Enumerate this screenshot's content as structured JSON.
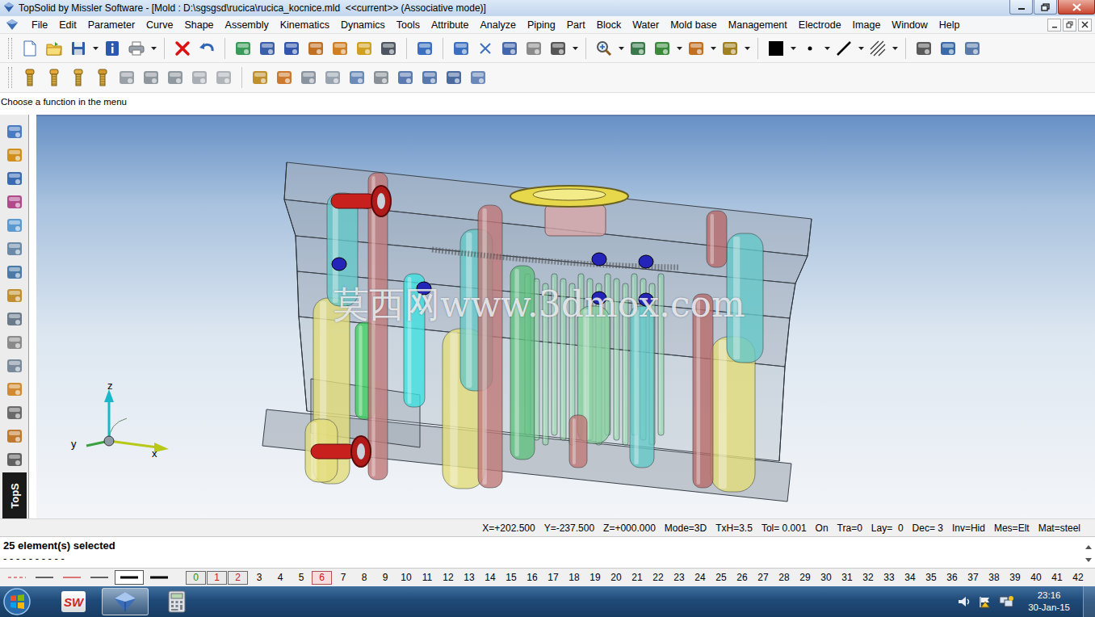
{
  "window": {
    "title": "TopSolid by Missler Software - [Mold : D:\\sgsgsd\\rucica\\rucica_kocnice.mld  <<current>> (Associative mode)]"
  },
  "menu": [
    "File",
    "Edit",
    "Parameter",
    "Curve",
    "Shape",
    "Assembly",
    "Kinematics",
    "Dynamics",
    "Tools",
    "Attribute",
    "Analyze",
    "Piping",
    "Part",
    "Block",
    "Water",
    "Mold base",
    "Management",
    "Electrode",
    "Image",
    "Window",
    "Help"
  ],
  "prompt": "Choose a function in the menu",
  "side_toolbar": {
    "label": "TopS"
  },
  "viewport": {
    "watermark": "莫西网www.3dmox.com",
    "axes": {
      "z": "z",
      "y": "y",
      "x": "x"
    }
  },
  "status_bar": [
    "X=+202.500",
    "Y=-237.500",
    "Z=+000.000",
    "Mode=3D",
    "TxH=3.5",
    "Tol= 0.001",
    "On",
    "Tra=0",
    "Lay=  0",
    "Dec= 3",
    "Inv=Hid",
    "Mes=Elt",
    "Mat=steel"
  ],
  "messages": [
    "25 element(s) selected",
    "- - - - - - - - - -"
  ],
  "line_styles": [
    {
      "kind": "dash",
      "color": "#d02020",
      "selected": false
    },
    {
      "kind": "solid",
      "color": "#000000",
      "selected": false
    },
    {
      "kind": "solid",
      "color": "#d02020",
      "selected": false
    },
    {
      "kind": "solid",
      "color": "#000000",
      "selected": false
    },
    {
      "kind": "thick",
      "color": "#000000",
      "selected": true
    },
    {
      "kind": "thick",
      "color": "#000000",
      "selected": false
    }
  ],
  "layers": [
    {
      "label": "0",
      "boxed": true,
      "selected": false,
      "color": "#1a8f1a"
    },
    {
      "label": "1",
      "boxed": true,
      "selected": false,
      "color": "#c02020"
    },
    {
      "label": "2",
      "boxed": true,
      "selected": false,
      "color": "#c02020"
    },
    {
      "label": "3",
      "boxed": false,
      "selected": false,
      "color": "#000000"
    },
    {
      "label": "4",
      "boxed": false,
      "selected": false,
      "color": "#000000"
    },
    {
      "label": "5",
      "boxed": false,
      "selected": false,
      "color": "#000000"
    },
    {
      "label": "6",
      "boxed": true,
      "selected": true,
      "color": "#c02020"
    },
    {
      "label": "7",
      "boxed": false,
      "selected": false,
      "color": "#000000"
    },
    {
      "label": "8",
      "boxed": false,
      "selected": false,
      "color": "#000000"
    },
    {
      "label": "9",
      "boxed": false,
      "selected": false,
      "color": "#000000"
    },
    {
      "label": "10",
      "boxed": false,
      "selected": false,
      "color": "#000000"
    },
    {
      "label": "11",
      "boxed": false,
      "selected": false,
      "color": "#000000"
    },
    {
      "label": "12",
      "boxed": false,
      "selected": false,
      "color": "#000000"
    },
    {
      "label": "13",
      "boxed": false,
      "selected": false,
      "color": "#000000"
    },
    {
      "label": "14",
      "boxed": false,
      "selected": false,
      "color": "#000000"
    },
    {
      "label": "15",
      "boxed": false,
      "selected": false,
      "color": "#000000"
    },
    {
      "label": "16",
      "boxed": false,
      "selected": false,
      "color": "#000000"
    },
    {
      "label": "17",
      "boxed": false,
      "selected": false,
      "color": "#000000"
    },
    {
      "label": "18",
      "boxed": false,
      "selected": false,
      "color": "#000000"
    },
    {
      "label": "19",
      "boxed": false,
      "selected": false,
      "color": "#000000"
    },
    {
      "label": "20",
      "boxed": false,
      "selected": false,
      "color": "#000000"
    },
    {
      "label": "21",
      "boxed": false,
      "selected": false,
      "color": "#000000"
    },
    {
      "label": "22",
      "boxed": false,
      "selected": false,
      "color": "#000000"
    },
    {
      "label": "23",
      "boxed": false,
      "selected": false,
      "color": "#000000"
    },
    {
      "label": "24",
      "boxed": false,
      "selected": false,
      "color": "#000000"
    },
    {
      "label": "25",
      "boxed": false,
      "selected": false,
      "color": "#000000"
    },
    {
      "label": "26",
      "boxed": false,
      "selected": false,
      "color": "#000000"
    },
    {
      "label": "27",
      "boxed": false,
      "selected": false,
      "color": "#000000"
    },
    {
      "label": "28",
      "boxed": false,
      "selected": false,
      "color": "#000000"
    },
    {
      "label": "29",
      "boxed": false,
      "selected": false,
      "color": "#000000"
    },
    {
      "label": "30",
      "boxed": false,
      "selected": false,
      "color": "#000000"
    },
    {
      "label": "31",
      "boxed": false,
      "selected": false,
      "color": "#000000"
    },
    {
      "label": "32",
      "boxed": false,
      "selected": false,
      "color": "#000000"
    },
    {
      "label": "33",
      "boxed": false,
      "selected": false,
      "color": "#000000"
    },
    {
      "label": "34",
      "boxed": false,
      "selected": false,
      "color": "#000000"
    },
    {
      "label": "35",
      "boxed": false,
      "selected": false,
      "color": "#000000"
    },
    {
      "label": "36",
      "boxed": false,
      "selected": false,
      "color": "#000000"
    },
    {
      "label": "37",
      "boxed": false,
      "selected": false,
      "color": "#000000"
    },
    {
      "label": "38",
      "boxed": false,
      "selected": false,
      "color": "#000000"
    },
    {
      "label": "39",
      "boxed": false,
      "selected": false,
      "color": "#000000"
    },
    {
      "label": "40",
      "boxed": false,
      "selected": false,
      "color": "#000000"
    },
    {
      "label": "41",
      "boxed": false,
      "selected": false,
      "color": "#000000"
    },
    {
      "label": "42",
      "boxed": false,
      "selected": false,
      "color": "#000000"
    }
  ],
  "taskbar": {
    "apps": [
      {
        "kind": "solidworks",
        "label": "SW",
        "selected": false
      },
      {
        "kind": "topsolid",
        "selected": true
      },
      {
        "kind": "calculator",
        "selected": false
      }
    ],
    "time": "23:16",
    "date": "30-Jan-15"
  }
}
